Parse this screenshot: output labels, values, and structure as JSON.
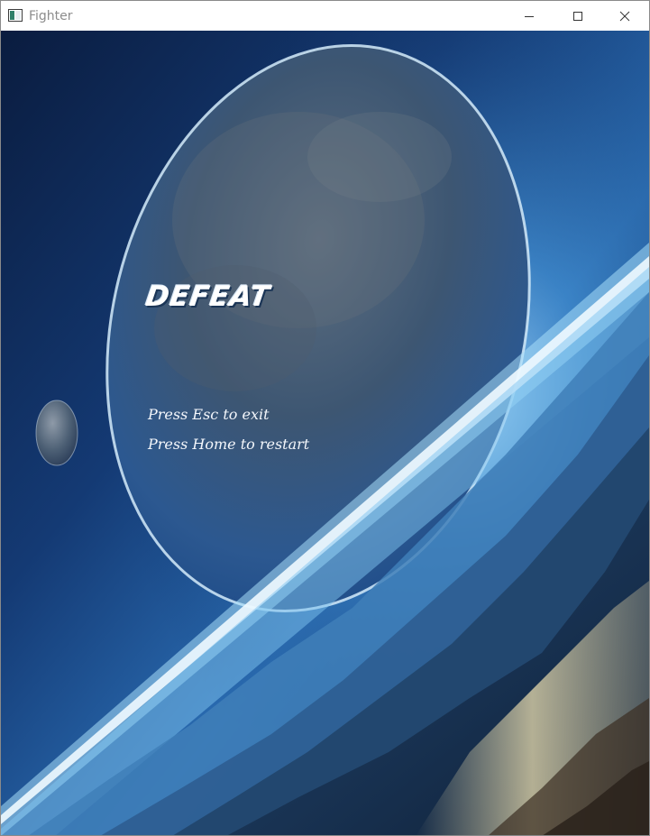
{
  "window": {
    "title": "Fighter",
    "controls": {
      "minimize": "minimize-icon",
      "maximize": "maximize-icon",
      "close": "close-icon"
    }
  },
  "game": {
    "status_title": "DEFEAT",
    "instructions": [
      "Press Esc to exit",
      "Press Home to restart"
    ]
  },
  "colors": {
    "space_dark": "#0b2047",
    "space_mid": "#1c4f8f",
    "horizon_glow": "#dff6ff",
    "planet_rim": "#cfe6f7",
    "dust": "#e9dcae",
    "text": "#ffffff"
  }
}
